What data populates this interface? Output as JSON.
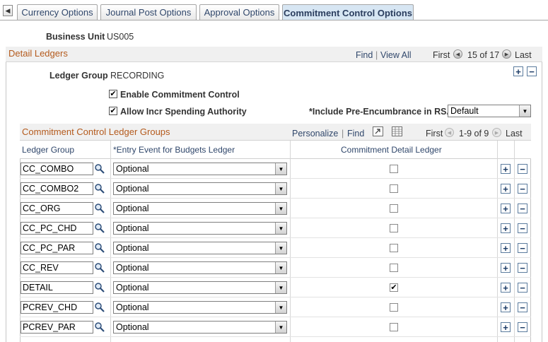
{
  "tabs": [
    {
      "label": "Currency Options"
    },
    {
      "label": "Journal Post Options"
    },
    {
      "label": "Approval Options"
    },
    {
      "label": "Commitment Control Options"
    }
  ],
  "business_unit": {
    "label": "Business Unit",
    "value": "US005"
  },
  "detail_ledgers": {
    "title": "Detail Ledgers",
    "find": "Find",
    "sep": "|",
    "view_all": "View All",
    "first": "First",
    "count": "15 of 17",
    "last": "Last"
  },
  "ledger_group": {
    "label": "Ledger Group",
    "value": "RECORDING"
  },
  "options": {
    "enable_cc": "Enable Commitment Control",
    "allow_incr": "Allow Incr Spending Authority",
    "pre_encumbrance_label": "*Include Pre-Encumbrance in RSA",
    "pre_encumbrance_value": "Default"
  },
  "grid": {
    "title": "Commitment Control Ledger Groups",
    "personalize": "Personalize",
    "sep": "|",
    "find": "Find",
    "first": "First",
    "count": "1-9 of 9",
    "last": "Last",
    "columns": [
      "Ledger Group",
      "*Entry Event for Budgets Ledger",
      "Commitment Detail Ledger"
    ],
    "rows": [
      {
        "ledger": "CC_COMBO",
        "event": "Optional",
        "checked": false
      },
      {
        "ledger": "CC_COMBO2",
        "event": "Optional",
        "checked": false
      },
      {
        "ledger": "CC_ORG",
        "event": "Optional",
        "checked": false
      },
      {
        "ledger": "CC_PC_CHD",
        "event": "Optional",
        "checked": false
      },
      {
        "ledger": "CC_PC_PAR",
        "event": "Optional",
        "checked": false
      },
      {
        "ledger": "CC_REV",
        "event": "Optional",
        "checked": false
      },
      {
        "ledger": "DETAIL",
        "event": "Optional",
        "checked": true
      },
      {
        "ledger": "PCREV_CHD",
        "event": "Optional",
        "checked": false
      },
      {
        "ledger": "PCREV_PAR",
        "event": "Optional",
        "checked": false
      }
    ]
  },
  "colors": {
    "accent": "#b45a1c",
    "link": "#30476b",
    "active_tab": "#d7e6f3"
  }
}
